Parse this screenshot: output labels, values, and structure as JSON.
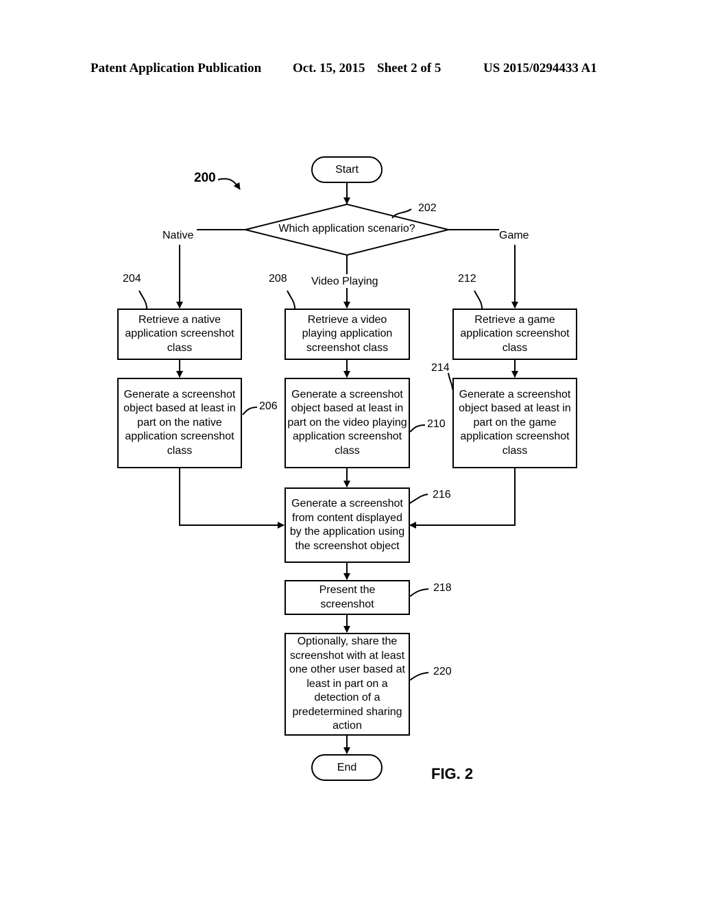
{
  "header": {
    "left": "Patent Application Publication",
    "date": "Oct. 15, 2015",
    "sheet": "Sheet 2 of 5",
    "number": "US 2015/0294433 A1"
  },
  "figure": {
    "ref": "200",
    "caption": "FIG. 2"
  },
  "nodes": {
    "start": "Start",
    "decision": "Which application scenario?",
    "decision_ref": "202",
    "retrieve_native": "Retrieve a native application screenshot class",
    "retrieve_native_ref": "204",
    "generate_native": "Generate a screenshot object based at least in part on the native application screenshot class",
    "generate_native_ref": "206",
    "retrieve_video": "Retrieve a video playing application screenshot class",
    "retrieve_video_ref": "208",
    "generate_video": "Generate a screenshot object based at least in part on the video playing application screenshot class",
    "generate_video_ref": "210",
    "retrieve_game": "Retrieve a game application screenshot class",
    "retrieve_game_ref": "212",
    "generate_game": "Generate a screenshot object based at least in part on the game application screenshot class",
    "generate_game_ref": "214",
    "generate_screenshot": "Generate a screenshot from content displayed by the application using the screenshot object",
    "generate_screenshot_ref": "216",
    "present": "Present the screenshot",
    "present_ref": "218",
    "share": "Optionally, share the screenshot with at least one other user based at least in part on a detection of a predetermined sharing action",
    "share_ref": "220",
    "end": "End"
  },
  "branches": {
    "native": "Native",
    "video": "Video Playing",
    "game": "Game"
  }
}
